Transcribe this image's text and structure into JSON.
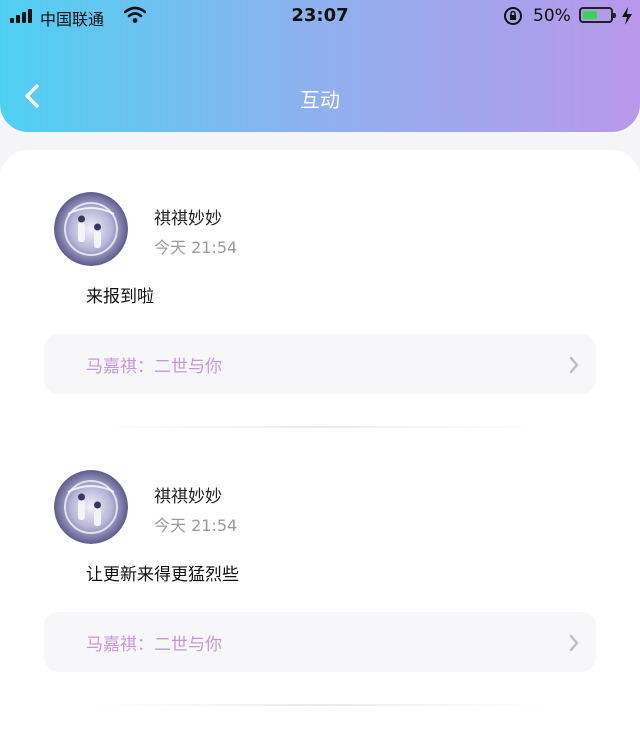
{
  "status_bar": {
    "carrier": "中国联通",
    "time": "23:07",
    "battery": "50%"
  },
  "header": {
    "title": "互动"
  },
  "posts": [
    {
      "author": "祺祺妙妙",
      "date": "今天 21:54",
      "content": "来报到啦",
      "reference": "马嘉祺：二世与你"
    },
    {
      "author": "祺祺妙妙",
      "date": "今天 21:54",
      "content": "让更新来得更猛烈些",
      "reference": "马嘉祺：二世与你"
    }
  ],
  "colors": {
    "header_gradient_start": "#4fd0f2",
    "header_gradient_end": "#b898ea",
    "reference_text": "#c896dc"
  }
}
